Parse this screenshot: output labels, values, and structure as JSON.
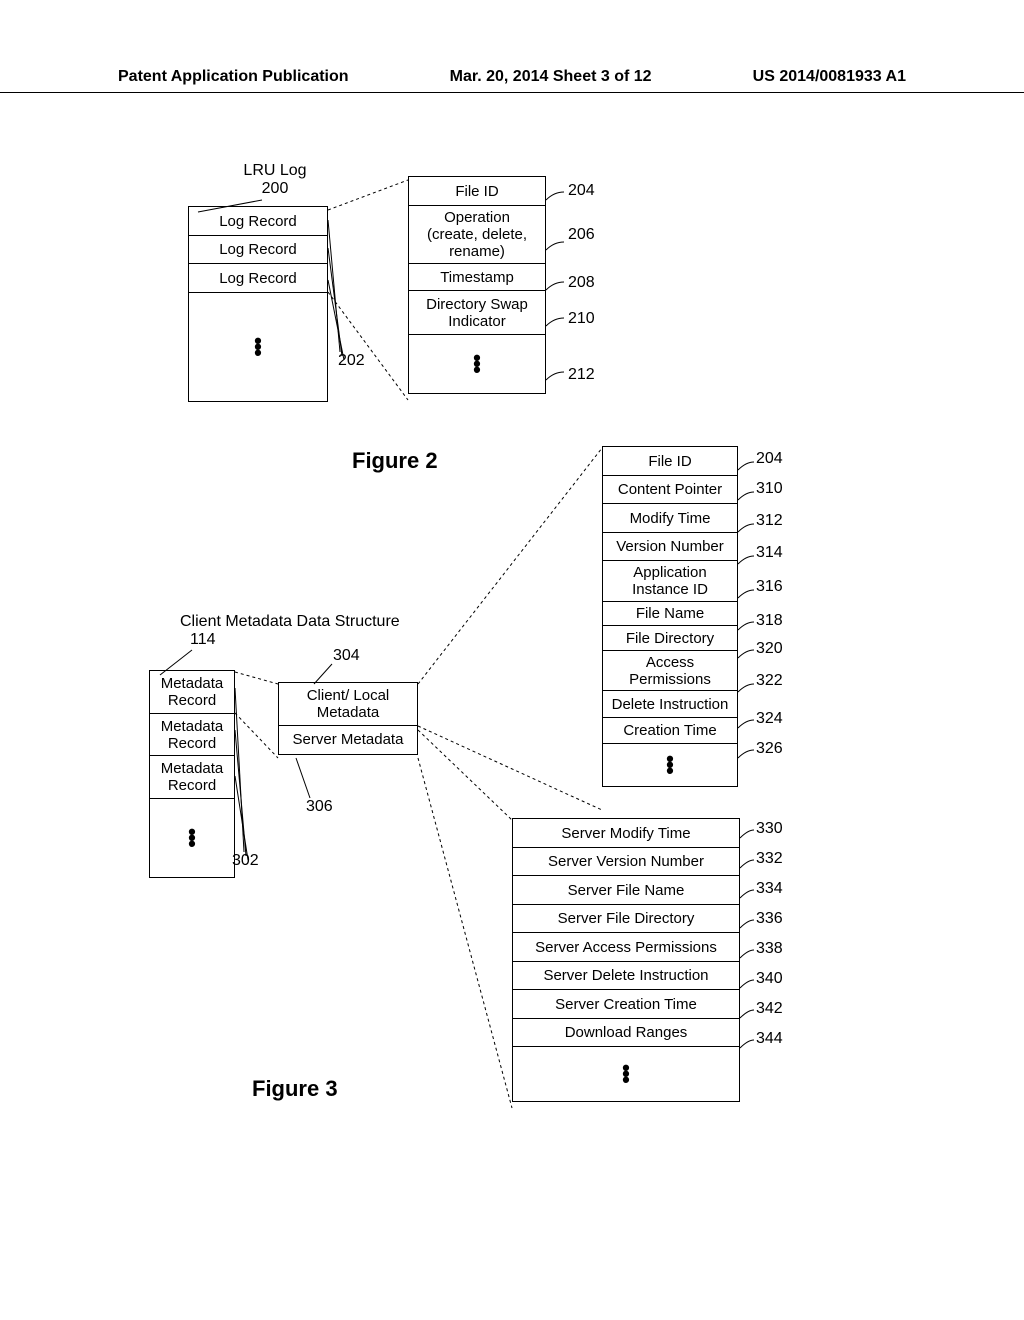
{
  "header": {
    "left": "Patent Application Publication",
    "center": "Mar. 20, 2014  Sheet 3 of 12",
    "right": "US 2014/0081933 A1"
  },
  "fig2": {
    "lru_title_line1": "LRU Log",
    "lru_title_line2": "200",
    "log_records": [
      "Log Record",
      "Log Record",
      "Log Record"
    ],
    "ref202": "202",
    "detail": {
      "rows": [
        "File ID",
        "Operation\n(create, delete,\nrename)",
        "Timestamp",
        "Directory Swap\nIndicator"
      ]
    },
    "refs": {
      "r204": "204",
      "r206": "206",
      "r208": "208",
      "r210": "210",
      "r212": "212"
    },
    "title": "Figure 2"
  },
  "fig3": {
    "cmds_line1": "Client Metadata Data Structure",
    "cmds_line2": "114",
    "meta_records": [
      "Metadata\nRecord",
      "Metadata\nRecord",
      "Metadata\nRecord"
    ],
    "ref302": "302",
    "mid": {
      "client": "Client/ Local\nMetadata",
      "server": "Server Metadata",
      "ref304": "304",
      "ref306": "306"
    },
    "client_detail": {
      "rows": [
        "File ID",
        "Content Pointer",
        "Modify Time",
        "Version Number",
        "Application\nInstance ID",
        "File Name",
        "File Directory",
        "Access\nPermissions",
        "Delete Instruction",
        "Creation Time"
      ],
      "refs": [
        "204",
        "310",
        "312",
        "314",
        "316",
        "318",
        "320",
        "322",
        "324",
        "326"
      ]
    },
    "server_detail": {
      "rows": [
        "Server Modify Time",
        "Server Version Number",
        "Server File Name",
        "Server File Directory",
        "Server Access Permissions",
        "Server Delete Instruction",
        "Server Creation Time",
        "Download Ranges"
      ],
      "refs": [
        "330",
        "332",
        "334",
        "336",
        "338",
        "340",
        "342",
        "344"
      ]
    },
    "title": "Figure 3"
  }
}
